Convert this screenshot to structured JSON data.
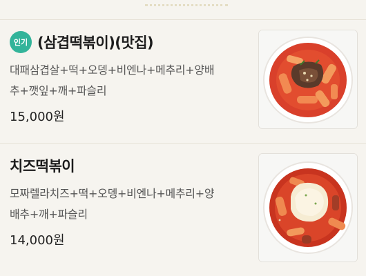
{
  "menu": [
    {
      "badge": "인기",
      "name": "(삼겹떡볶이)(맛집)",
      "desc_line1": "대패삼겹살+떡+오뎅+비엔나+메추리+양배",
      "desc_line2": "추+깻잎+깨+파슬리",
      "price": "15,000원",
      "image": "samgyeop-tteokbokki-photo"
    },
    {
      "name": "치즈떡볶이",
      "desc_line1": "모짜렐라치즈+떡+오뎅+비엔나+메추리+양",
      "desc_line2": "배추+깨+파슬리",
      "price": "14,000원",
      "image": "cheese-tteokbokki-photo"
    }
  ]
}
